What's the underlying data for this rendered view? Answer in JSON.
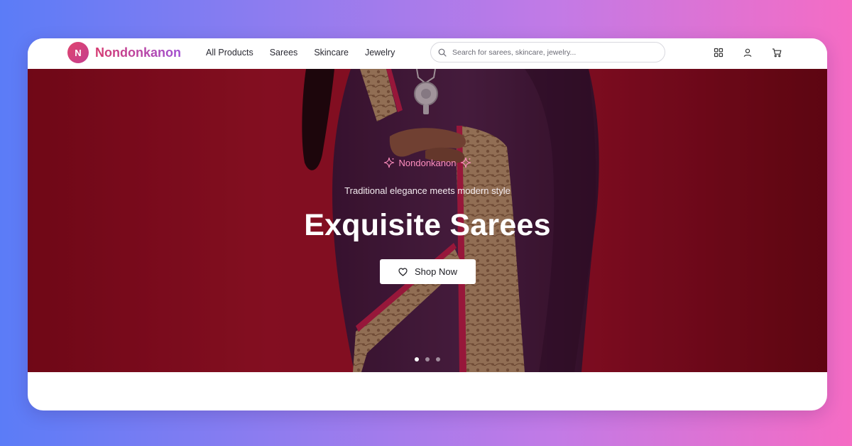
{
  "brand": {
    "initial": "N",
    "name": "Nondonkanon"
  },
  "nav": [
    {
      "label": "All Products"
    },
    {
      "label": "Sarees"
    },
    {
      "label": "Skincare"
    },
    {
      "label": "Jewelry"
    }
  ],
  "search": {
    "placeholder": "Search for sarees, skincare, jewelry...",
    "icon": "search-icon"
  },
  "header_icons": [
    "grid-icon",
    "user-icon",
    "cart-icon"
  ],
  "hero": {
    "brand_tag": "Nondonkanon",
    "tagline": "Traditional elegance meets modern style",
    "headline": "Exquisite Sarees",
    "cta_label": "Shop Now",
    "cta_icon": "heart-icon",
    "slides_total": 3,
    "active_slide": 1
  },
  "colors": {
    "brand_pink": "#d63a70",
    "hero_red": "#a2132a",
    "sparkle": "#ff8fbf"
  }
}
